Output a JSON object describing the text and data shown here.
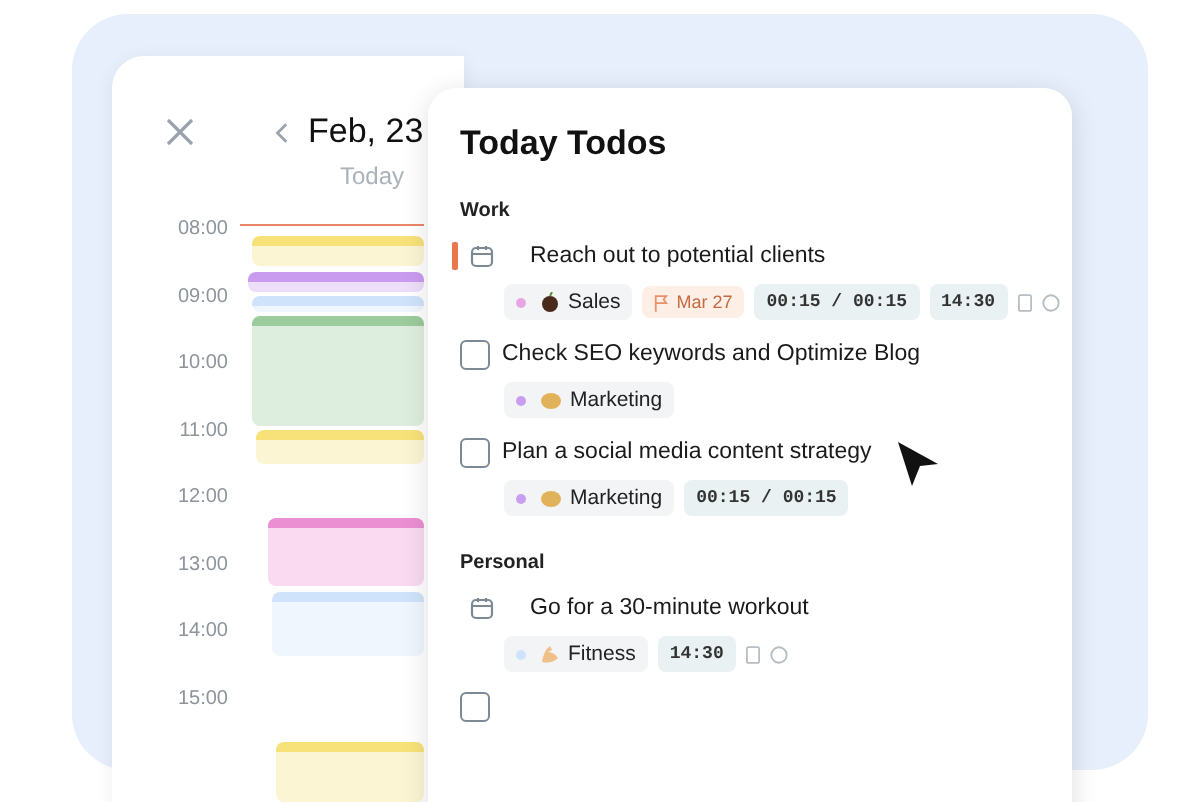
{
  "calendar": {
    "date": "Feb, 23",
    "subtitle": "Today",
    "hours": [
      "08:00",
      "09:00",
      "10:00",
      "11:00",
      "12:00",
      "13:00",
      "14:00",
      "15:00"
    ],
    "events": [
      {
        "color": "#f7e27a"
      },
      {
        "color": "#c99cf0"
      },
      {
        "color": "#cfe3fa"
      },
      {
        "color": "#9ccb9c"
      },
      {
        "color": "#f7e27a"
      },
      {
        "color": "#ec8fd2"
      },
      {
        "color": "#cfe3fa"
      },
      {
        "color": "#f7e27a"
      }
    ]
  },
  "todos": {
    "title": "Today Todos",
    "sections": [
      {
        "name": "Work",
        "items": [
          {
            "kind": "scheduled",
            "title": "Reach out to potential clients",
            "priority": true,
            "tag": {
              "label": "Sales",
              "color": "#e9a6e6"
            },
            "due": "Mar 27",
            "timer": "00:15 / 00:15",
            "time": "14:30",
            "extras": true
          },
          {
            "kind": "checkbox",
            "checked": false,
            "title": "Check SEO keywords and Optimize Blog",
            "tag": {
              "label": "Marketing",
              "color": "#c89ef0"
            }
          },
          {
            "kind": "checkbox",
            "checked": false,
            "title": "Plan a social media content strategy",
            "tag": {
              "label": "Marketing",
              "color": "#c89ef0"
            },
            "timer": "00:15 / 00:15"
          }
        ]
      },
      {
        "name": "Personal",
        "items": [
          {
            "kind": "scheduled",
            "priority": false,
            "title": "Go for a 30-minute workout",
            "tag": {
              "label": "Fitness",
              "color": "#cfe3fa"
            },
            "time": "14:30",
            "extras": true
          },
          {
            "kind": "checkbox",
            "checked": false
          }
        ]
      }
    ]
  }
}
